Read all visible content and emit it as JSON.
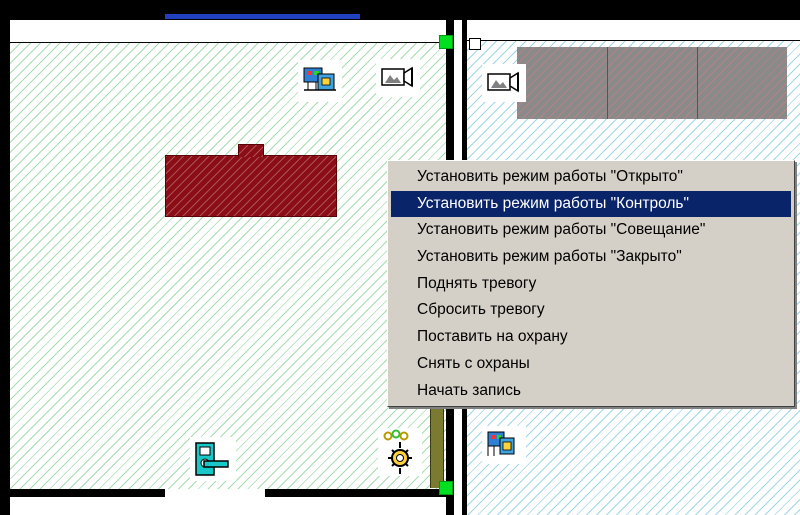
{
  "context_menu": {
    "highlighted_index": 1,
    "items": [
      {
        "label": "Установить режим работы \"Открыто\""
      },
      {
        "label": "Установить режим работы \"Контроль\""
      },
      {
        "label": "Установить режим работы \"Совещание\""
      },
      {
        "label": "Установить режим работы \"Закрыто\""
      },
      {
        "label": "Поднять тревогу"
      },
      {
        "label": "Сбросить тревогу"
      },
      {
        "label": "Поставить на охрану"
      },
      {
        "label": "Снять с охраны"
      },
      {
        "label": "Начать запись"
      }
    ]
  },
  "colors": {
    "menu_background": "#d4d0c8",
    "menu_highlight": "#0a246a",
    "zone_left_hatch": "#a6dcb0",
    "zone_right_hatch": "#9fd7e6",
    "table": "#8b0d16",
    "handle": "#00e020",
    "wall": "#000000"
  },
  "icons": {
    "left_room": [
      "camera-icon",
      "access-control-device-icon",
      "door-lock-icon",
      "fire-detector-icon"
    ],
    "right_room": [
      "camera-icon",
      "access-control-device-icon"
    ]
  }
}
